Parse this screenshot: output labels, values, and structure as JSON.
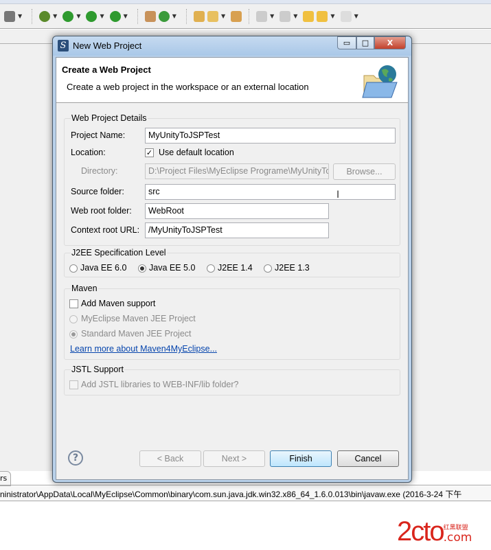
{
  "toolbar": {
    "icons": [
      "camera-icon",
      "debug-icon",
      "run-icon",
      "run-coverage-icon",
      "external-tools-icon",
      "new-package-icon",
      "new-class-icon",
      "open-folder-icon",
      "pen-icon",
      "open-type-icon",
      "next-annotation-icon",
      "previous-annotation-icon",
      "last-edit-icon",
      "back-icon",
      "forward-icon"
    ]
  },
  "bottom": {
    "tab_label": "rs",
    "status_text": "ninistrator\\AppData\\Local\\MyEclipse\\Common\\binary\\com.sun.java.jdk.win32.x86_64_1.6.0.013\\bin\\javaw.exe (2016-3-24 下午"
  },
  "watermark": {
    "main": "2cto",
    "cn": "红黑联盟",
    "com": ".com"
  },
  "dialog": {
    "title": "New Web Project",
    "header_title": "Create a Web Project",
    "header_desc": "Create a web project in the workspace or an external location",
    "details": {
      "label": "Web Project Details",
      "project_name_label": "Project Name:",
      "project_name": "MyUnityToJSPTest",
      "location_label": "Location:",
      "use_default_label": "Use default location",
      "use_default_checked": true,
      "directory_label": "Directory:",
      "directory": "D:\\Project Files\\MyEclipse Programe\\MyUnityToJSPTest",
      "browse_label": "Browse...",
      "source_folder_label": "Source folder:",
      "source_folder": "src",
      "web_root_label": "Web root folder:",
      "web_root": "WebRoot",
      "context_root_label": "Context root URL:",
      "context_root": "/MyUnityToJSPTest"
    },
    "j2ee": {
      "label": "J2EE Specification Level",
      "options": [
        "Java EE 6.0",
        "Java EE 5.0",
        "J2EE 1.4",
        "J2EE 1.3"
      ],
      "selected": "Java EE 5.0"
    },
    "maven": {
      "label": "Maven",
      "add_support_label": "Add Maven support",
      "add_support_checked": false,
      "option1": "MyEclipse Maven JEE Project",
      "option2": "Standard Maven JEE Project",
      "selected": "Standard Maven JEE Project",
      "link": "Learn more about Maven4MyEclipse..."
    },
    "jstl": {
      "label": "JSTL Support",
      "add_label": "Add JSTL libraries to WEB-INF/lib folder?",
      "checked": false
    },
    "buttons": {
      "help": "?",
      "back": "< Back",
      "next": "Next >",
      "finish": "Finish",
      "cancel": "Cancel"
    },
    "window": {
      "minimize": "▭",
      "maximize": "□",
      "close": "X"
    }
  }
}
